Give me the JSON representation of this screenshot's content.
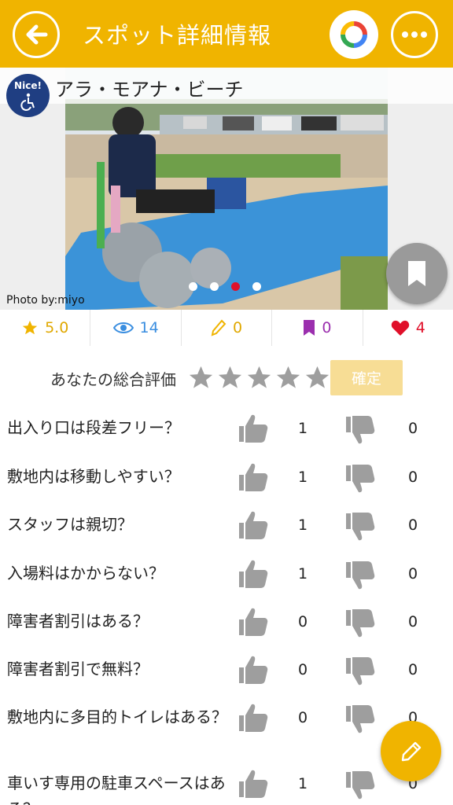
{
  "header": {
    "title": "スポット詳細情報",
    "back_icon": "arrow-left-icon",
    "share_icon": "google-icon",
    "more_icon": "more-horizontal-icon",
    "accent_color": "#f0b400"
  },
  "spot": {
    "name": "アラ・モアナ・ビーチ",
    "badge": "Nice!",
    "photo_credit": "Photo by:miyo",
    "photo_count": 4,
    "active_photo": 3
  },
  "stats": {
    "rating": "5.0",
    "views": "14",
    "edits": "0",
    "bookmarks": "0",
    "likes": "4"
  },
  "rating": {
    "label": "あなたの総合評価",
    "max_stars": 5,
    "selected_stars": 0,
    "confirm_label": "確定"
  },
  "questions": [
    {
      "text": "出入り口は段差フリー？",
      "up": "1",
      "down": "0"
    },
    {
      "text": "敷地内は移動しやすい？",
      "up": "1",
      "down": "0"
    },
    {
      "text": "スタッフは親切？",
      "up": "1",
      "down": "0"
    },
    {
      "text": "入場料はかからない？",
      "up": "1",
      "down": "0"
    },
    {
      "text": "障害者割引はある？",
      "up": "0",
      "down": "0"
    },
    {
      "text": "障害者割引で無料？",
      "up": "0",
      "down": "0"
    },
    {
      "text": "敷地内に多目的トイレはある？",
      "up": "0",
      "down": "0"
    },
    {
      "text": "車いす専用の駐車スペースはある？",
      "up": "1",
      "down": "0"
    }
  ]
}
